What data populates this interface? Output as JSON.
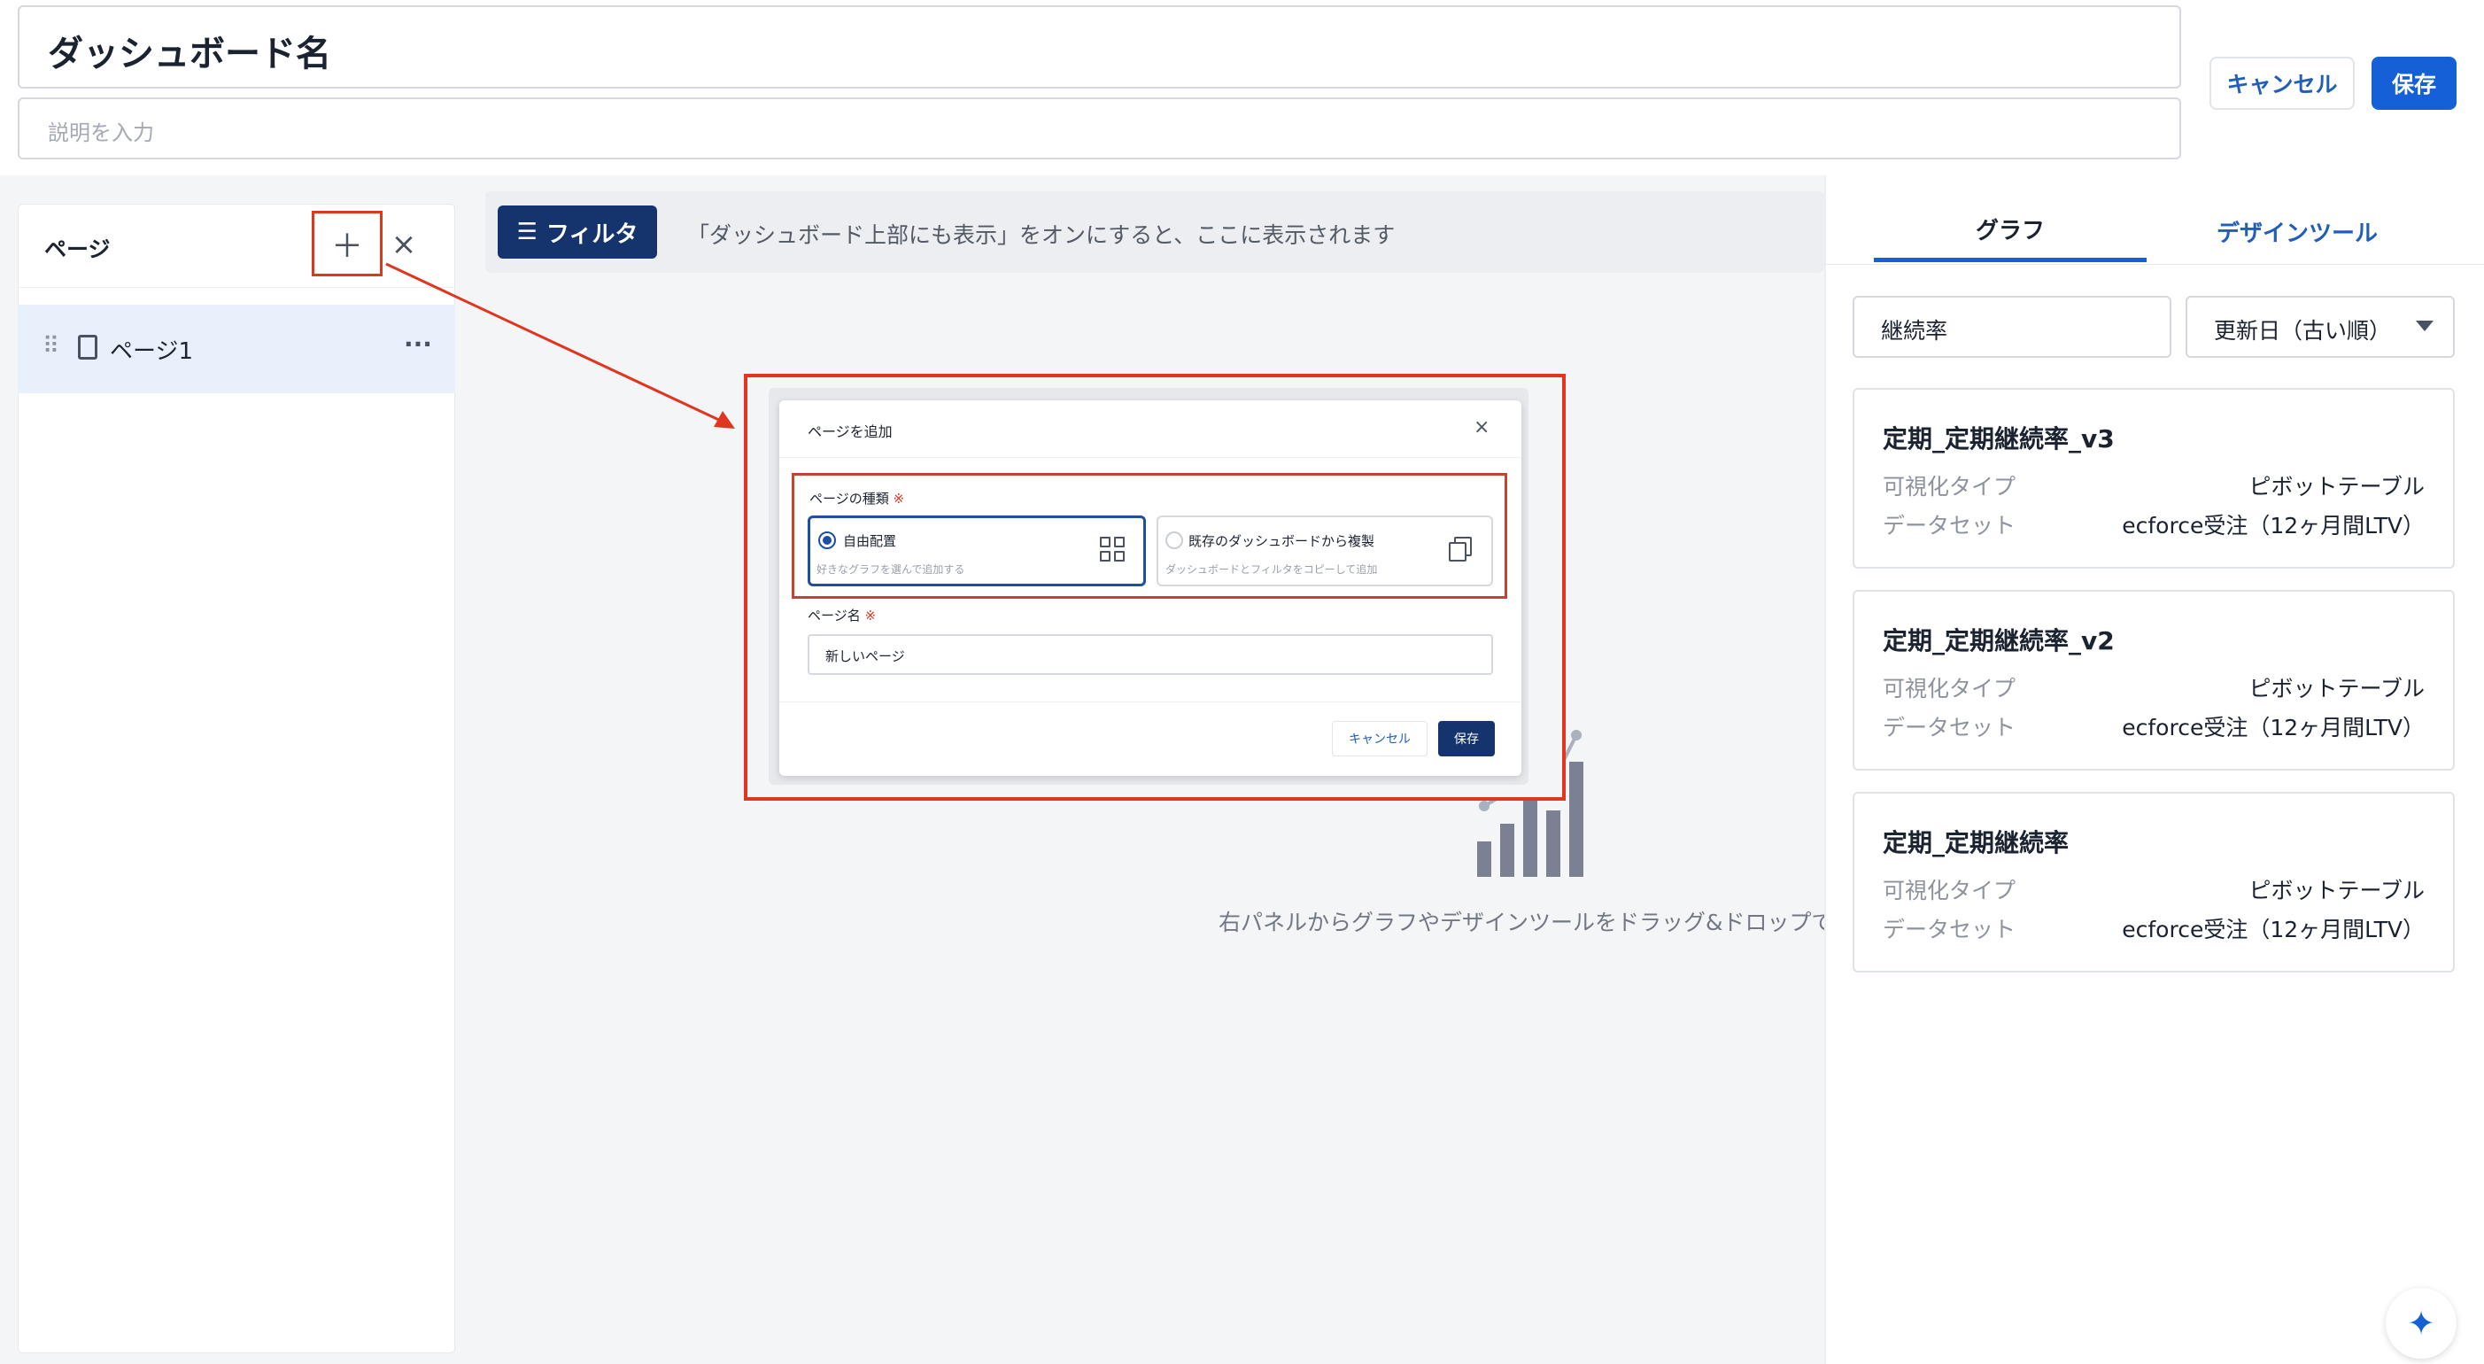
{
  "header": {
    "title": "ダッシュボード名",
    "description_placeholder": "説明を入力",
    "cancel_label": "キャンセル",
    "save_label": "保存"
  },
  "pages_panel": {
    "title": "ページ",
    "add_icon": "plus-icon",
    "close_icon": "close-icon",
    "items": [
      {
        "label": "ページ1",
        "icon": "document-icon"
      }
    ]
  },
  "filter_bar": {
    "button_label": "フィルタ",
    "hint": "「ダッシュボード上部にも表示」をオンにすると、ここに表示されます"
  },
  "canvas": {
    "empty_message": "右パネルからグラフやデザインツールをドラッグ&ドロップで追"
  },
  "add_page_modal": {
    "title": "ページを追加",
    "type_label": "ページの種類",
    "required_mark": "※",
    "options": [
      {
        "label": "自由配置",
        "sub": "好きなグラフを選んで追加する",
        "selected": true
      },
      {
        "label": "既存のダッシュボードから複製",
        "sub": "ダッシュボードとフィルタをコピーして追加",
        "selected": false
      }
    ],
    "name_label": "ページ名",
    "name_value": "新しいページ",
    "cancel_label": "キャンセル",
    "save_label": "保存"
  },
  "right_panel": {
    "tabs": [
      {
        "label": "グラフ",
        "active": true
      },
      {
        "label": "デザインツール",
        "active": false
      }
    ],
    "search_value": "継続率",
    "sort_value": "更新日（古い順）",
    "cards": [
      {
        "title": "定期_定期継続率_v3",
        "type_key": "可視化タイプ",
        "type_val": "ピボットテーブル",
        "dataset_key": "データセット",
        "dataset_val": "ecforce受注（12ヶ月間LTV）"
      },
      {
        "title": "定期_定期継続率_v2",
        "type_key": "可視化タイプ",
        "type_val": "ピボットテーブル",
        "dataset_key": "データセット",
        "dataset_val": "ecforce受注（12ヶ月間LTV）"
      },
      {
        "title": "定期_定期継続率",
        "type_key": "可視化タイプ",
        "type_val": "ピボットテーブル",
        "dataset_key": "データセット",
        "dataset_val": "ecforce受注（12ヶ月間LTV）"
      }
    ]
  },
  "colors": {
    "primary": "#1560d6",
    "navy": "#15346e",
    "annotation": "#e0351f"
  }
}
